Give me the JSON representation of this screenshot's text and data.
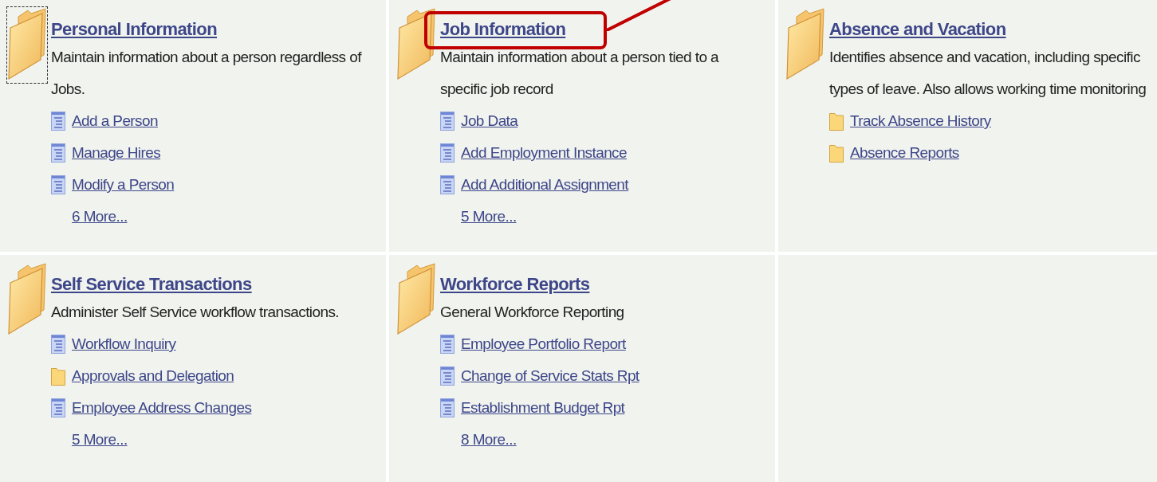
{
  "sections": [
    {
      "title": "Personal Information",
      "focused": true,
      "highlighted": false,
      "description": "Maintain information about a person regardless of Jobs.",
      "items": [
        {
          "kind": "page",
          "label": "Add a Person"
        },
        {
          "kind": "page",
          "label": "Manage Hires"
        },
        {
          "kind": "page",
          "label": "Modify a Person"
        }
      ],
      "more": "6 More..."
    },
    {
      "title": "Job Information",
      "focused": false,
      "highlighted": true,
      "description": "Maintain information about a person tied to a specific job record",
      "items": [
        {
          "kind": "page",
          "label": "Job Data"
        },
        {
          "kind": "page",
          "label": "Add Employment Instance"
        },
        {
          "kind": "page",
          "label": "Add Additional Assignment"
        }
      ],
      "more": "5 More..."
    },
    {
      "title": "Absence and Vacation",
      "focused": false,
      "highlighted": false,
      "description": "Identifies absence and vacation, including specific types of leave. Also allows working time monitoring",
      "items": [
        {
          "kind": "folder",
          "label": "Track Absence History"
        },
        {
          "kind": "folder",
          "label": "Absence Reports"
        }
      ]
    },
    {
      "title": "Self Service Transactions",
      "focused": false,
      "highlighted": false,
      "description": "Administer Self Service workflow transactions.",
      "items": [
        {
          "kind": "page",
          "label": "Workflow Inquiry"
        },
        {
          "kind": "folder",
          "label": "Approvals and Delegation"
        },
        {
          "kind": "page",
          "label": "Employee Address Changes"
        }
      ],
      "more": "5 More..."
    },
    {
      "title": "Workforce Reports",
      "focused": false,
      "highlighted": false,
      "description": "General Workforce Reporting",
      "items": [
        {
          "kind": "page",
          "label": "Employee Portfolio Report"
        },
        {
          "kind": "page",
          "label": "Change of Service Stats Rpt"
        },
        {
          "kind": "page",
          "label": "Establishment Budget Rpt"
        }
      ],
      "more": "8 More..."
    }
  ]
}
